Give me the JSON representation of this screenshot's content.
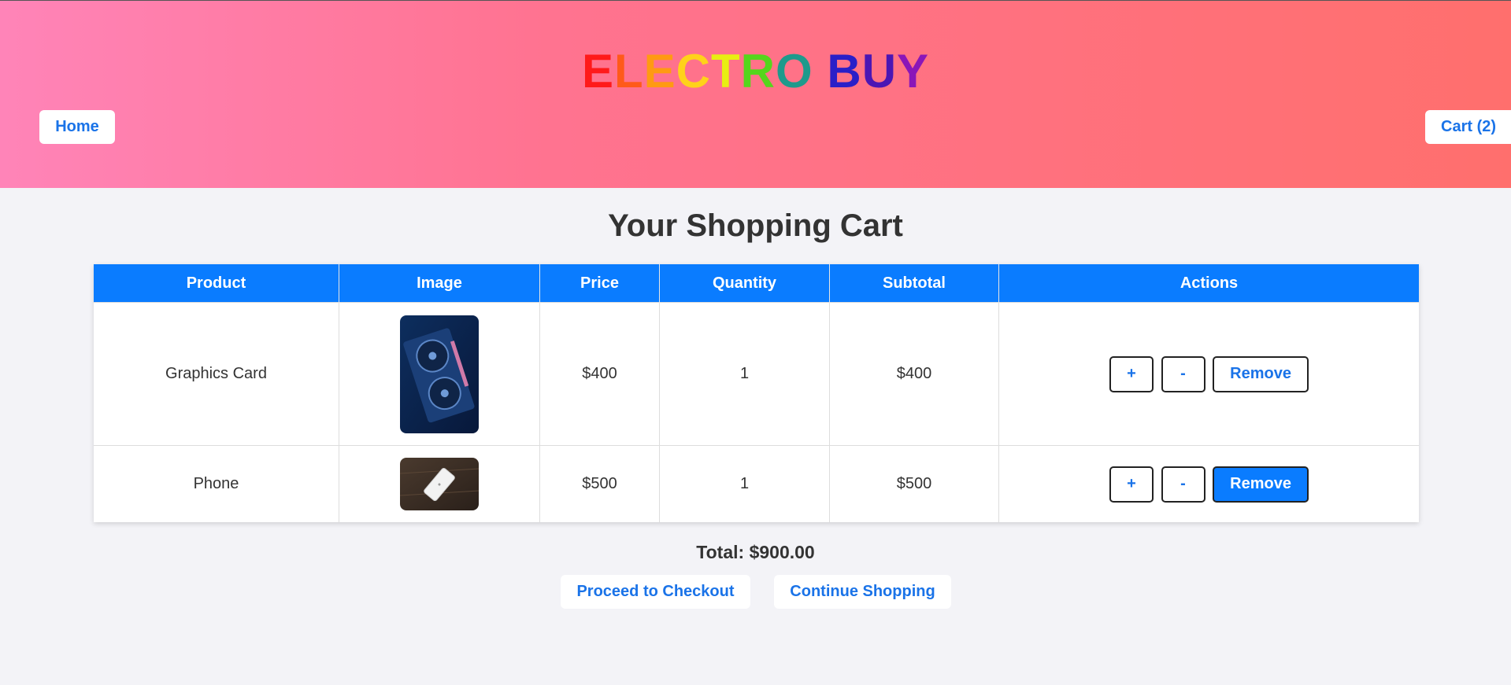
{
  "header": {
    "logo_letters": [
      {
        "ch": "E",
        "color": "#ff1a1a"
      },
      {
        "ch": "L",
        "color": "#ff5a1a"
      },
      {
        "ch": "E",
        "color": "#ff9a12"
      },
      {
        "ch": "C",
        "color": "#ffd21a"
      },
      {
        "ch": "T",
        "color": "#e8ee12"
      },
      {
        "ch": "R",
        "color": "#55d61c"
      },
      {
        "ch": "O",
        "color": "#1e9a8c"
      },
      {
        "ch": " ",
        "color": "#000000"
      },
      {
        "ch": "B",
        "color": "#2a1fc8"
      },
      {
        "ch": "U",
        "color": "#4b16b4"
      },
      {
        "ch": "Y",
        "color": "#8a16b8"
      }
    ],
    "home_label": "Home",
    "cart_label": "Cart (2)"
  },
  "main": {
    "title": "Your Shopping Cart",
    "columns": [
      "Product",
      "Image",
      "Price",
      "Quantity",
      "Subtotal",
      "Actions"
    ],
    "rows": [
      {
        "product": "Graphics Card",
        "price": "$400",
        "quantity": "1",
        "subtotal": "$400",
        "image": "graphics-card-photo"
      },
      {
        "product": "Phone",
        "price": "$500",
        "quantity": "1",
        "subtotal": "$500",
        "image": "phone-photo"
      }
    ],
    "actions": {
      "increase": "+",
      "decrease": "-",
      "remove": "Remove"
    },
    "total": "Total: $900.00",
    "checkout_label": "Proceed to Checkout",
    "continue_label": "Continue Shopping"
  },
  "colors": {
    "accent": "#0a7cff",
    "link": "#1a73e8",
    "header_gradient_start": "#ff84b8",
    "header_gradient_end": "#ff6f6d",
    "background": "#f3f3f7"
  }
}
